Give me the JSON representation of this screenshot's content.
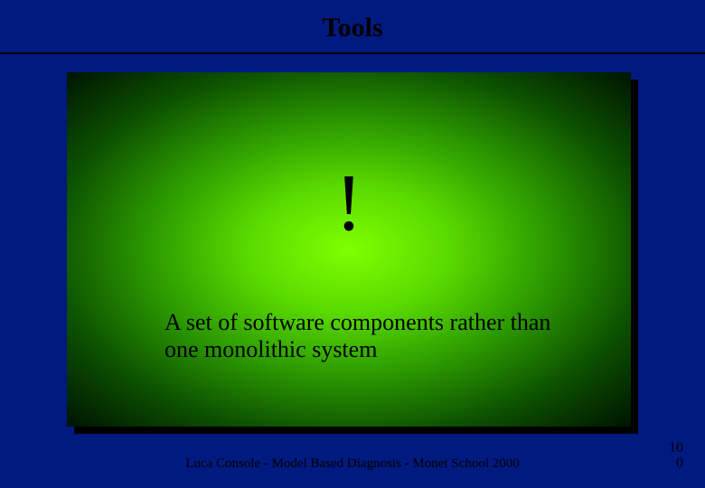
{
  "title": "Tools",
  "content": {
    "exclaim": "!",
    "body": "A set of software components rather than one monolithic system"
  },
  "footer": "Luca Console - Model Based Diagnosis - Monet School 2000",
  "page": {
    "top": "10",
    "bottom": "0"
  }
}
